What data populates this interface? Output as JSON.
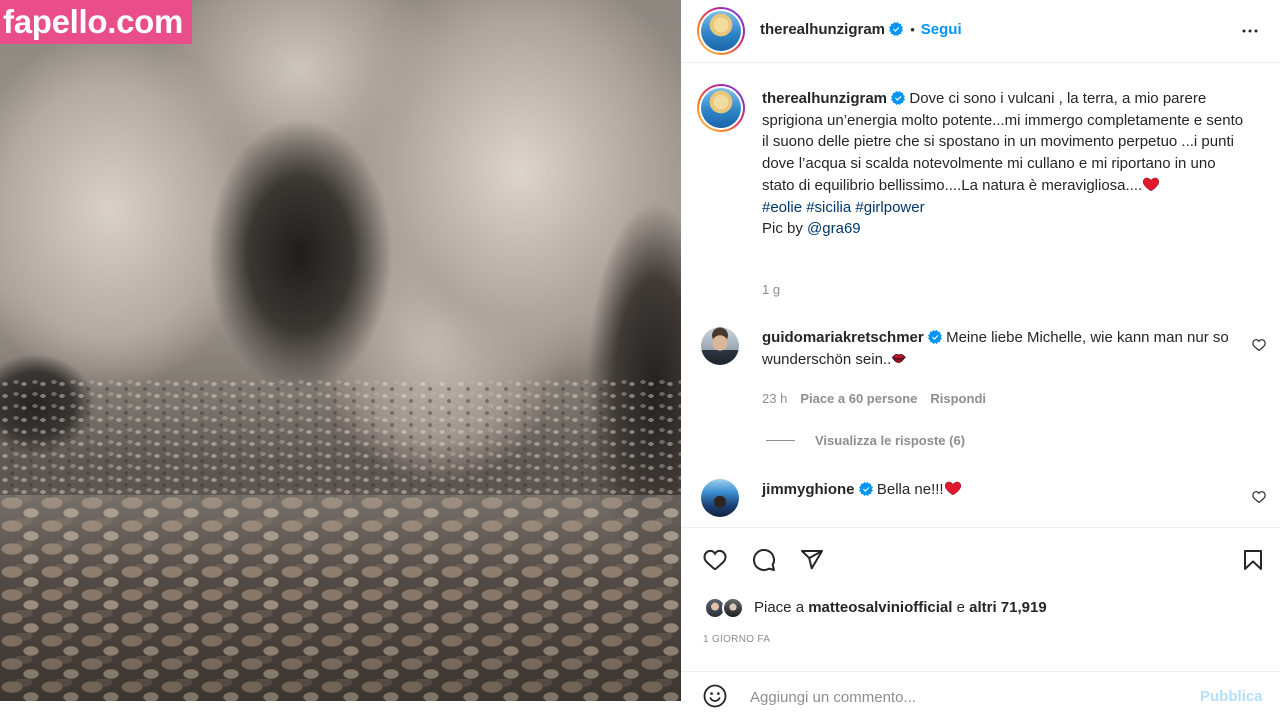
{
  "watermark": {
    "text": "fapello.com"
  },
  "header": {
    "username": "therealhunzigram",
    "separator": "•",
    "follow_label": "Segui"
  },
  "caption": {
    "username": "therealhunzigram",
    "text": "Dove ci sono i vulcani , la terra, a mio parere sprigiona un’energia molto potente...mi immergo completamente e sento il suono delle pietre che si spostano in un movimento perpetuo ...i punti dove l’acqua si scalda notevolmente mi cullano e mi riportano in uno stato di equilibrio bellissimo....La natura è meravigliosa....",
    "emoji_icon": "red-heart-emoji-icon",
    "hashtags": [
      "#eolie",
      "#sicilia",
      "#girlpower"
    ],
    "credit_prefix": "Pic by",
    "credit_mention": "@gra69",
    "age": "1 g"
  },
  "comments": [
    {
      "username": "guidomariakretschmer",
      "text": "Meine liebe Michelle, wie kann man nur so wunderschön sein..",
      "emoji_icon": "kiss-mark-emoji-icon",
      "time": "23 h",
      "likes": "Piace a 60 persone",
      "reply_label": "Rispondi",
      "view_replies": "Visualizza le risposte (6)"
    },
    {
      "username": "jimmyghione",
      "text": "Bella ne!!!",
      "emoji_icon": "red-heart-emoji-icon"
    }
  ],
  "likes": {
    "prefix": "Piace a",
    "user": "matteosalviniofficial",
    "conjunction": "e",
    "others": "altri 71,919"
  },
  "timestamp": "1 giorno fa",
  "comment_box": {
    "placeholder": "Aggiungi un commento...",
    "submit_label": "Pubblica"
  },
  "icons": {
    "verified": "verified-badge-icon",
    "more": "more-horizontal-icon",
    "comment_like": "heart-outline-icon",
    "like": "heart-outline-icon",
    "comment": "comment-icon",
    "share": "share-paper-plane-icon",
    "save": "bookmark-icon",
    "emoji": "emoji-smiley-icon"
  },
  "colors": {
    "accent": "#0095f6",
    "text": "#262626",
    "muted": "#8e8e8e",
    "hashtag": "#00376b",
    "watermark_bg": "#e94e8b",
    "heart": "#ed4956",
    "publish_disabled": "#b2dffc"
  }
}
